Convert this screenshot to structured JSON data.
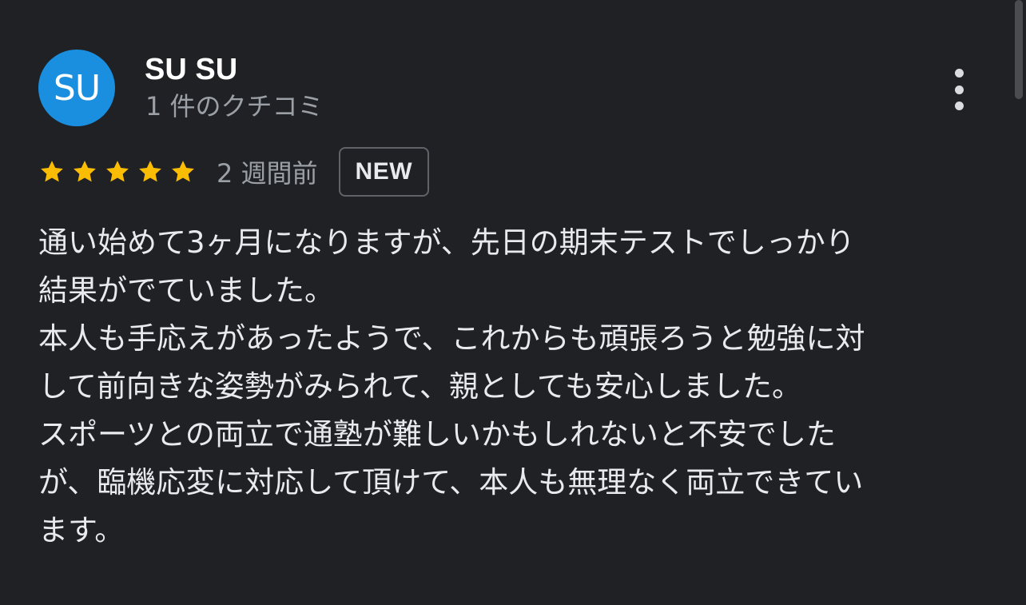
{
  "reviewer": {
    "initials": "SU",
    "name": "SU SU",
    "review_count": "1 件のクチコミ",
    "avatar_color": "#1a8fe0"
  },
  "rating": {
    "stars": 5,
    "star_color": "#fbbc04",
    "date": "2 週間前",
    "badge": "NEW"
  },
  "menu": {
    "icon": "more-vert-icon"
  },
  "review": {
    "lines": [
      "通い始めて3ヶ月になりますが、先日の期末テストでしっかり",
      "結果がでていました。",
      "本人も手応えがあったようで、これからも頑張ろうと勉強に対",
      "して前向きな姿勢がみられて、親としても安心しました。",
      "スポーツとの両立で通塾が難しいかもしれないと不安でした",
      "が、臨機応変に対応して頂けて、本人も無理なく両立できてい",
      "ます。"
    ]
  }
}
